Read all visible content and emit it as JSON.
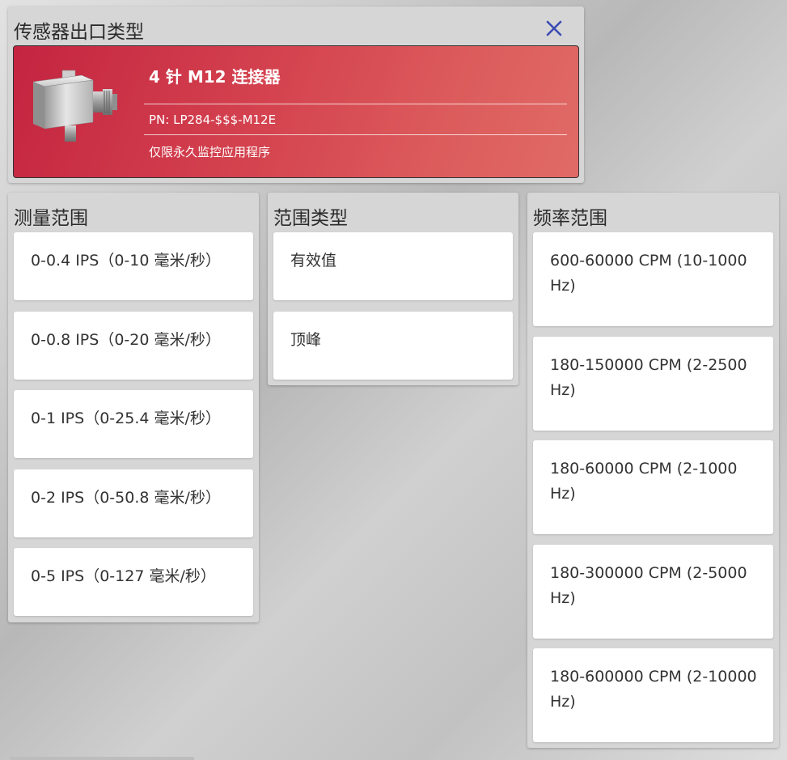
{
  "output_type": {
    "title": "传感器出口类型",
    "close_icon": "close-icon",
    "selected": {
      "name": "4 针 M12 连接器",
      "pn": "PN: LP284-$$$-M12E",
      "note": "仅限永久监控应用程序",
      "image": "sensor-image"
    }
  },
  "measurement_range": {
    "title": "测量范围",
    "options": [
      "0-0.4 IPS（0-10 毫米/秒）",
      "0-0.8 IPS（0-20 毫米/秒）",
      "0-1 IPS（0-25.4 毫米/秒）",
      "0-2 IPS（0-50.8 毫米/秒）",
      "0-5 IPS（0-127 毫米/秒）"
    ]
  },
  "range_type": {
    "title": "范围类型",
    "options": [
      "有效值",
      "顶峰"
    ]
  },
  "frequency_range": {
    "title": "频率范围",
    "options": [
      "600-60000 CPM (10-1000 Hz)",
      "180-150000 CPM (2-2500 Hz)",
      "180-60000 CPM (2-1000 Hz)",
      "180-300000 CPM (2-5000 Hz)",
      "180-600000 CPM (2-10000 Hz)"
    ]
  },
  "colors": {
    "accent_red": "#c42440",
    "close_blue": "#3b4bb3"
  }
}
